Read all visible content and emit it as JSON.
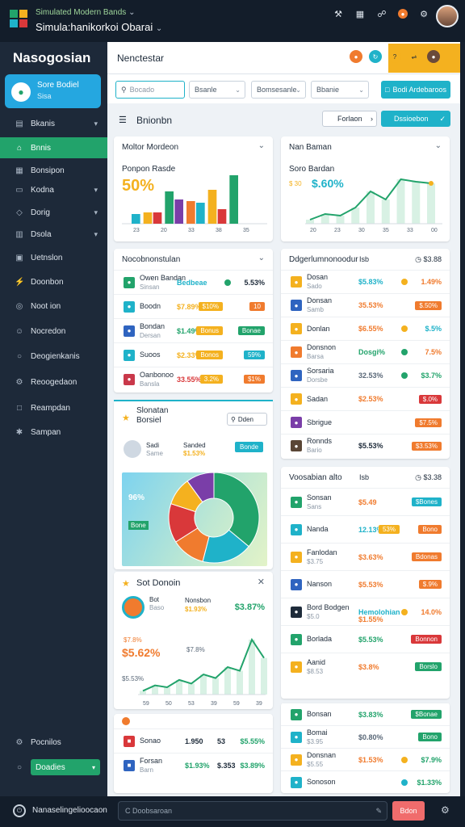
{
  "window": {
    "subtitle": "Simulated Modern Bands",
    "title": "Simula:hanikorkoi Obarai"
  },
  "brand": {
    "name": "Nasogosian"
  },
  "side_card": {
    "title": "Sore Bodiel",
    "sub": "Sisa"
  },
  "nav": [
    {
      "label": "Bkanis",
      "icon": "chart-icon"
    },
    {
      "label": "Bnnis",
      "icon": "home-icon",
      "active": true
    },
    {
      "label": "Bonsipon",
      "icon": "grid-icon"
    },
    {
      "label": "Kodna",
      "icon": "folder-icon"
    },
    {
      "label": "Dorig",
      "icon": "tag-icon"
    },
    {
      "label": "Dsola",
      "icon": "table-icon"
    },
    {
      "label": "Uetnslon",
      "icon": "calendar-icon"
    },
    {
      "label": "Doonbon",
      "icon": "bolt-icon"
    },
    {
      "label": "Noot ion",
      "icon": "bell-icon"
    },
    {
      "label": "Nocredon",
      "icon": "user-icon"
    },
    {
      "label": "Deogienkanis",
      "icon": "globe-icon"
    },
    {
      "label": "Reoogedaon",
      "icon": "gear-icon"
    },
    {
      "label": "Reampdan",
      "icon": "doc-icon"
    },
    {
      "label": "Sampan",
      "icon": "settings-icon"
    }
  ],
  "side_bottom": {
    "label1": "Pocnilos",
    "label2": "Doadies"
  },
  "main_header": {
    "title": "Nenctestar"
  },
  "filters": {
    "search_placeholder": "Bocado",
    "select1": "Bsanle",
    "select2": "Bomsesanle",
    "select3": "Bbanie",
    "button": "Bodi Ardebaroos"
  },
  "section": {
    "title": "Bnionbn",
    "btn1": "Forlaon",
    "btn2": "Dssioebon"
  },
  "card1": {
    "title": "Moltor Mordeon",
    "big": "50%",
    "label": "Ponpon Rasde"
  },
  "card2": {
    "title": "Nan Baman",
    "label": "Soro Bardan",
    "big": "$.60%",
    "small": "$ 30"
  },
  "list1": {
    "title": "Nocobnonstulan",
    "rows": [
      {
        "name": "Owen Bandan",
        "sub": "Sinsan",
        "mid": "Bedbeae",
        "val": "5.53%",
        "icon_color": "#22a36b"
      },
      {
        "name": "Boodn",
        "mid": "$7.89%",
        "pill": "10",
        "pill2": "$10%",
        "val": "",
        "icon_color": "#1fb2c9"
      },
      {
        "name": "Bondan",
        "sub": "Dersan",
        "mid": "$1.49%",
        "pill": "Bonae",
        "pill2": "Bonus",
        "val": "",
        "icon_color": "#2f64c0"
      },
      {
        "name": "Suoos",
        "mid": "$2.33%",
        "pill": "59%",
        "pill2": "Bonos",
        "val": "",
        "icon_color": "#1fb2c9"
      },
      {
        "name": "Oanbonoo",
        "sub": "Bansla",
        "mid": "33.55%",
        "pill": "$1%",
        "pill2": "3.2%",
        "val": "",
        "icon_color": "#c9384a"
      }
    ]
  },
  "list2": {
    "title": "Ddgerlumnonoodur",
    "col": "Isb",
    "total": "$3.88",
    "rows": [
      {
        "name": "Dosan",
        "sub": "Sado",
        "mid": "$5.83%",
        "val": "1.49%",
        "icon_color": "#f4b11f"
      },
      {
        "name": "Donsan",
        "sub": "Samb",
        "mid": "35.53%",
        "pill": "$.50%",
        "icon_color": "#2f64c0"
      },
      {
        "name": "Donlan",
        "mid": "$6.55%",
        "val": "$.5%",
        "icon_color": "#f4b11f"
      },
      {
        "name": "Donsnon",
        "sub": "Barsa",
        "mid": "Dosgi%",
        "val": "7.5%",
        "icon_color": "#f07b2e"
      },
      {
        "name": "Sorsaria",
        "sub": "Dorsbe",
        "mid": "32.53%",
        "val": "$3.7%",
        "icon_color": "#2f64c0"
      },
      {
        "name": "Sadan",
        "mid": "$2.53%",
        "pill": "$.0%",
        "icon_color": "#f4b11f"
      },
      {
        "name": "Sbrigue",
        "mid": "",
        "pill": "$7.5%",
        "icon_color": "#7a3ea8"
      },
      {
        "name": "Ronnds",
        "sub": "Bario",
        "mid": "$5.53%",
        "pill": "$3.53%",
        "icon_color": "#5a4636"
      }
    ]
  },
  "pie_card": {
    "title": "Slonatan",
    "sub": "Borsiel",
    "search": "Dden",
    "person": "Sadi",
    "person_sub": "Same",
    "stat": "Sanded",
    "stat_val": "$1.53%",
    "pill": "Bonde",
    "label1": "96%",
    "label2": "Bone"
  },
  "trend_card": {
    "title": "Sot Donoin",
    "name": "Bot",
    "name_sub": "Baso",
    "val_label": "Nonsbon",
    "val": "$1.93%",
    "big": "$5.62%",
    "small": "$7.8%",
    "right_big": "$3.87%",
    "y_label": "$5.53%",
    "xticks": [
      "59",
      "50",
      "53",
      "39",
      "59",
      "39"
    ]
  },
  "bottom_rows": [
    {
      "name": "Sonao",
      "mid": "1.950",
      "v1": "53",
      "val": "$5.55%",
      "icon_color": "#d9383a"
    },
    {
      "name": "Forsan",
      "sub": "Barn",
      "mid": "$1.93%",
      "v1": "$.353",
      "val": "$3.89%",
      "icon_color": "#2f64c0"
    }
  ],
  "list3": {
    "title": "Voosabian alto",
    "col": "Isb",
    "total": "$3.38",
    "rows": [
      {
        "name": "Sonsan",
        "sub": "Sans",
        "mid": "$5.49",
        "pill": "$Bones",
        "icon_color": "#22a36b"
      },
      {
        "name": "Nanda",
        "mid": "12.13%",
        "pill2": "53%",
        "pill": "Bono",
        "icon_color": "#1fb2c9"
      },
      {
        "name": "Fanlodan",
        "sub": "$3.75",
        "mid": "$3.63%",
        "pill": "Bdonas",
        "icon_color": "#f4b11f"
      },
      {
        "name": "Nanson",
        "mid": "$5.53%",
        "pill": "$.9%",
        "icon_color": "#2f64c0"
      },
      {
        "name": "Bord Bodgen",
        "sub": "$5.0",
        "mid": "Hemolohian",
        "mid2": "$1.55%",
        "val": "14.0%",
        "icon_color": "#1e2b3a"
      },
      {
        "name": "Borlada",
        "mid": "$5.53%",
        "pill": "Bonnon",
        "icon_color": "#22a36b"
      },
      {
        "name": "Aanid",
        "sub": "$8.53",
        "mid": "$3.8%",
        "pill": "Borslo",
        "icon_color": "#f4b11f"
      }
    ]
  },
  "list4": {
    "rows": [
      {
        "name": "Bonsan",
        "mid": "$3.83%",
        "pill": "$Bonae",
        "icon_color": "#22a36b"
      },
      {
        "name": "Bomai",
        "sub": "$3.95",
        "mid": "$0.80%",
        "pill": "Bono",
        "icon_color": "#1fb2c9"
      },
      {
        "name": "Donsnan",
        "sub": "$5.55",
        "mid": "$1.53%",
        "val": "$7.9%",
        "icon_color": "#f4b11f"
      },
      {
        "name": "Sonoson",
        "mid": "",
        "val": "$1.33%",
        "icon_color": "#1fb2c9"
      }
    ]
  },
  "bottombar": {
    "label": "Nanaselingelioocaon",
    "search": "C Doobsaroan",
    "button": "Bdon"
  },
  "colors": {
    "accent": "#22a36b",
    "cyan": "#1fb2c9",
    "orange": "#f07b2e",
    "yellow": "#f4b11f",
    "red": "#d9383a",
    "purple": "#7a3ea8",
    "blue": "#2f64c0"
  },
  "chart_data": [
    {
      "type": "bar",
      "categories": [
        "23",
        "20",
        "33",
        "38",
        "35"
      ],
      "series": [
        {
          "values": [
            12,
            14,
            30,
            26,
            18
          ]
        },
        {
          "values": [
            14,
            40,
            28,
            42,
            60
          ]
        }
      ]
    },
    {
      "type": "line",
      "x": [
        "20",
        "23",
        "30",
        "35",
        "33",
        "00"
      ],
      "series": [
        {
          "values": [
            5,
            12,
            10,
            20,
            40,
            30,
            55,
            52,
            50
          ]
        }
      ],
      "xticks": [
        "20",
        "23",
        "30",
        "35",
        "33",
        "00"
      ]
    },
    {
      "type": "pie",
      "values": [
        36,
        18,
        12,
        14,
        10,
        10
      ]
    }
  ]
}
